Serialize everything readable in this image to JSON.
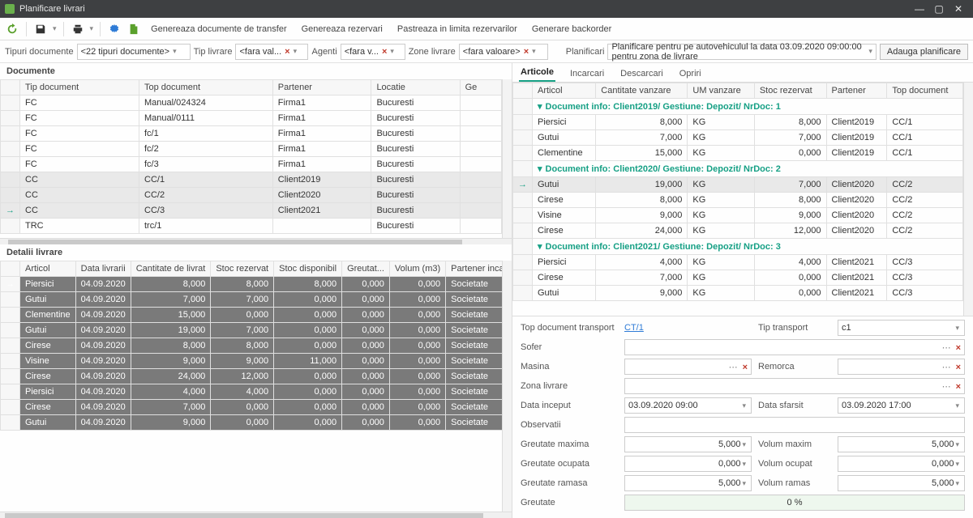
{
  "window": {
    "title": "Planificare livrari"
  },
  "toolbar_actions": [
    "Genereaza documente de transfer",
    "Genereaza rezervari",
    "Pastreaza in limita rezervarilor",
    "Generare backorder"
  ],
  "filters": {
    "tipuri_label": "Tipuri documente",
    "tipuri_value": "<22 tipuri documente>",
    "tip_livrare_label": "Tip livrare",
    "tip_livrare_value": "<fara val...",
    "agenti_label": "Agenti",
    "agenti_value": "<fara v...",
    "zone_label": "Zone livrare",
    "zone_value": "<fara valoare>"
  },
  "plan_filter": {
    "label": "Planificari",
    "value": "Planificare pentru  pe autovehiculul  la data 03.09.2020 09:00:00 pentru zona de livrare",
    "add_btn": "Adauga planificare"
  },
  "documente": {
    "title": "Documente",
    "cols": [
      "Tip document",
      "Top document",
      "Partener",
      "Locatie",
      "Ge"
    ],
    "rows": [
      {
        "tip": "FC",
        "top": "Manual/024324",
        "part": "Firma1",
        "loc": "Bucuresti"
      },
      {
        "tip": "FC",
        "top": "Manual/0111",
        "part": "Firma1",
        "loc": "Bucuresti"
      },
      {
        "tip": "FC",
        "top": "fc/1",
        "part": "Firma1",
        "loc": "Bucuresti"
      },
      {
        "tip": "FC",
        "top": "fc/2",
        "part": "Firma1",
        "loc": "Bucuresti"
      },
      {
        "tip": "FC",
        "top": "fc/3",
        "part": "Firma1",
        "loc": "Bucuresti"
      },
      {
        "tip": "CC",
        "top": "CC/1",
        "part": "Client2019",
        "loc": "Bucuresti",
        "sel": true
      },
      {
        "tip": "CC",
        "top": "CC/2",
        "part": "Client2020",
        "loc": "Bucuresti",
        "sel": true
      },
      {
        "tip": "CC",
        "top": "CC/3",
        "part": "Client2021",
        "loc": "Bucuresti",
        "sel": true,
        "arrow": true
      },
      {
        "tip": "TRC",
        "top": "trc/1",
        "part": "",
        "loc": "Bucuresti"
      }
    ]
  },
  "detalii": {
    "title": "Detalii livrare",
    "cols": [
      "Articol",
      "Data livrarii",
      "Cantitate de livrat",
      "Stoc rezervat",
      "Stoc disponibil",
      "Greutat...",
      "Volum (m3)",
      "Partener incarcare"
    ],
    "rows": [
      {
        "a": "Piersici",
        "d": "04.09.2020",
        "c": "8,000",
        "sr": "8,000",
        "sd": "8,000",
        "g": "0,000",
        "v": "0,000",
        "p": "Societate",
        "arrow": true
      },
      {
        "a": "Gutui",
        "d": "04.09.2020",
        "c": "7,000",
        "sr": "7,000",
        "sd": "0,000",
        "g": "0,000",
        "v": "0,000",
        "p": "Societate"
      },
      {
        "a": "Clementine",
        "d": "04.09.2020",
        "c": "15,000",
        "sr": "0,000",
        "sd": "0,000",
        "g": "0,000",
        "v": "0,000",
        "p": "Societate"
      },
      {
        "a": "Gutui",
        "d": "04.09.2020",
        "c": "19,000",
        "sr": "7,000",
        "sd": "0,000",
        "g": "0,000",
        "v": "0,000",
        "p": "Societate"
      },
      {
        "a": "Cirese",
        "d": "04.09.2020",
        "c": "8,000",
        "sr": "8,000",
        "sd": "0,000",
        "g": "0,000",
        "v": "0,000",
        "p": "Societate"
      },
      {
        "a": "Visine",
        "d": "04.09.2020",
        "c": "9,000",
        "sr": "9,000",
        "sd": "11,000",
        "g": "0,000",
        "v": "0,000",
        "p": "Societate"
      },
      {
        "a": "Cirese",
        "d": "04.09.2020",
        "c": "24,000",
        "sr": "12,000",
        "sd": "0,000",
        "g": "0,000",
        "v": "0,000",
        "p": "Societate"
      },
      {
        "a": "Piersici",
        "d": "04.09.2020",
        "c": "4,000",
        "sr": "4,000",
        "sd": "0,000",
        "g": "0,000",
        "v": "0,000",
        "p": "Societate"
      },
      {
        "a": "Cirese",
        "d": "04.09.2020",
        "c": "7,000",
        "sr": "0,000",
        "sd": "0,000",
        "g": "0,000",
        "v": "0,000",
        "p": "Societate"
      },
      {
        "a": "Gutui",
        "d": "04.09.2020",
        "c": "9,000",
        "sr": "0,000",
        "sd": "0,000",
        "g": "0,000",
        "v": "0,000",
        "p": "Societate"
      }
    ]
  },
  "right_tabs": [
    "Articole",
    "Incarcari",
    "Descarcari",
    "Opriri"
  ],
  "articole": {
    "cols": [
      "Articol",
      "Cantitate vanzare",
      "UM vanzare",
      "Stoc rezervat",
      "Partener",
      "Top document"
    ],
    "groups": [
      {
        "hdr": "Document info: Client2019/ Gestiune: Depozit/ NrDoc: 1",
        "rows": [
          {
            "a": "Piersici",
            "c": "8,000",
            "um": "KG",
            "s": "8,000",
            "p": "Client2019",
            "t": "CC/1"
          },
          {
            "a": "Gutui",
            "c": "7,000",
            "um": "KG",
            "s": "7,000",
            "p": "Client2019",
            "t": "CC/1"
          },
          {
            "a": "Clementine",
            "c": "15,000",
            "um": "KG",
            "s": "0,000",
            "p": "Client2019",
            "t": "CC/1"
          }
        ]
      },
      {
        "hdr": "Document info: Client2020/ Gestiune: Depozit/ NrDoc: 2",
        "rows": [
          {
            "a": "Gutui",
            "c": "19,000",
            "um": "KG",
            "s": "7,000",
            "p": "Client2020",
            "t": "CC/2",
            "arrow": true,
            "sel": true
          },
          {
            "a": "Cirese",
            "c": "8,000",
            "um": "KG",
            "s": "8,000",
            "p": "Client2020",
            "t": "CC/2"
          },
          {
            "a": "Visine",
            "c": "9,000",
            "um": "KG",
            "s": "9,000",
            "p": "Client2020",
            "t": "CC/2"
          },
          {
            "a": "Cirese",
            "c": "24,000",
            "um": "KG",
            "s": "12,000",
            "p": "Client2020",
            "t": "CC/2"
          }
        ]
      },
      {
        "hdr": "Document info: Client2021/ Gestiune: Depozit/ NrDoc: 3",
        "rows": [
          {
            "a": "Piersici",
            "c": "4,000",
            "um": "KG",
            "s": "4,000",
            "p": "Client2021",
            "t": "CC/3"
          },
          {
            "a": "Cirese",
            "c": "7,000",
            "um": "KG",
            "s": "0,000",
            "p": "Client2021",
            "t": "CC/3"
          },
          {
            "a": "Gutui",
            "c": "9,000",
            "um": "KG",
            "s": "0,000",
            "p": "Client2021",
            "t": "CC/3"
          }
        ]
      }
    ]
  },
  "transport_form": {
    "top_doc_label": "Top document transport",
    "top_doc": "CT/1",
    "tip_transport_label": "Tip transport",
    "tip_transport": "c1",
    "sofer_label": "Sofer",
    "sofer": "",
    "masina_label": "Masina",
    "masina": "",
    "remorca_label": "Remorca",
    "remorca": "",
    "zona_label": "Zona livrare",
    "zona": "",
    "data_inceput_label": "Data inceput",
    "data_inceput": "03.09.2020 09:00",
    "data_sfarsit_label": "Data sfarsit",
    "data_sfarsit": "03.09.2020 17:00",
    "observatii_label": "Observatii",
    "observatii": "",
    "greutate_max_label": "Greutate maxima",
    "greutate_max": "5,000",
    "volum_max_label": "Volum maxim",
    "volum_max": "5,000",
    "greutate_ocupata_label": "Greutate ocupata",
    "greutate_ocupata": "0,000",
    "volum_ocupat_label": "Volum ocupat",
    "volum_ocupat": "0,000",
    "greutate_ramasa_label": "Greutate ramasa",
    "greutate_ramasa": "5,000",
    "volum_ramas_label": "Volum ramas",
    "volum_ramas": "5,000",
    "greutate_label": "Greutate",
    "greutate_pct": "0 %"
  }
}
